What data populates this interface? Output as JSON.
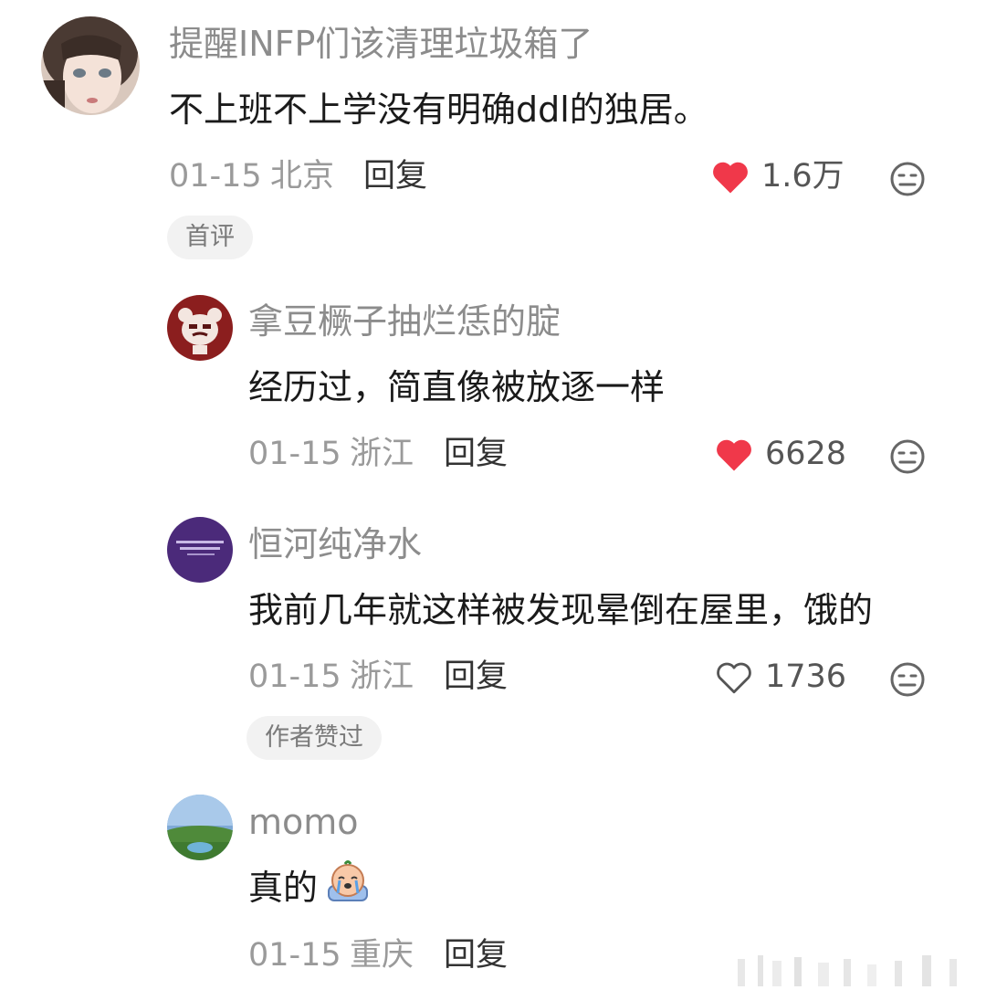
{
  "colors": {
    "like_active": "#f0384a",
    "name": "#8c8c8c",
    "text": "#1a1a1a",
    "meta": "#9a9a9a"
  },
  "comments": [
    {
      "username": "提醒INFP们该清理垃圾箱了",
      "text": "不上班不上学没有明确ddl的独居。",
      "date": "01-15",
      "location": "北京",
      "reply": "回复",
      "likes": "1.6万",
      "liked": true,
      "tag": "首评"
    },
    {
      "username": "拿豆橛子抽烂恁的腚",
      "text": "经历过，简直像被放逐一样",
      "date": "01-15",
      "location": "浙江",
      "reply": "回复",
      "likes": "6628",
      "liked": true
    },
    {
      "username": "恒河纯净水",
      "text": "我前几年就这样被发现晕倒在屋里，饿的",
      "date": "01-15",
      "location": "浙江",
      "reply": "回复",
      "likes": "1736",
      "liked": false,
      "tag": "作者赞过"
    },
    {
      "username": "momo",
      "text": "真的",
      "emoji": "crying-face-sticker",
      "date": "01-15",
      "location": "重庆",
      "reply": "回复"
    }
  ]
}
